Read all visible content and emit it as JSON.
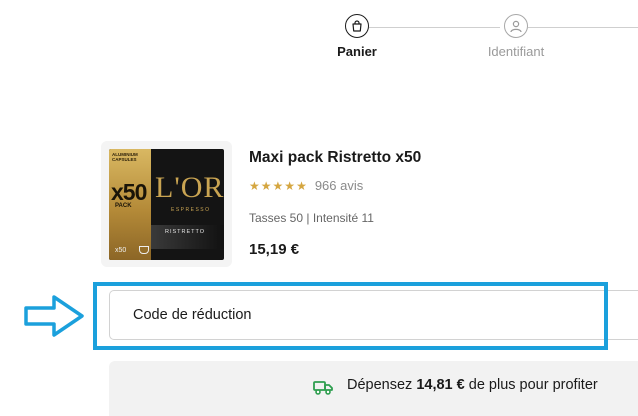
{
  "stepper": {
    "steps": [
      {
        "label": "Panier",
        "icon": "shopping-bag-icon",
        "state": "active"
      },
      {
        "label": "Identifiant",
        "icon": "user-icon",
        "state": "inactive"
      }
    ]
  },
  "product": {
    "title": "Maxi pack Ristretto x50",
    "rating_stars": 5,
    "reviews": "966 avis",
    "meta": "Tasses 50 | Intensité 11",
    "price": "15,19 €",
    "image": {
      "badge": "ALUMINIUM CAPSULES",
      "count": "x50",
      "pack": "PACK",
      "brand": "L'OR",
      "line": "ESPRESSO",
      "variety": "RISTRETTO",
      "cups": "x50"
    }
  },
  "promo": {
    "label": "Code de réduction",
    "annotation_icon": "arrow-right-icon"
  },
  "shipping": {
    "prefix": "Dépensez",
    "amount": "14,81 €",
    "suffix": "de plus pour profiter",
    "icon": "truck-icon"
  },
  "colors": {
    "accent_green": "#2e9e4f",
    "highlight_blue": "#1ba0dc",
    "star_gold": "#d5a640"
  }
}
